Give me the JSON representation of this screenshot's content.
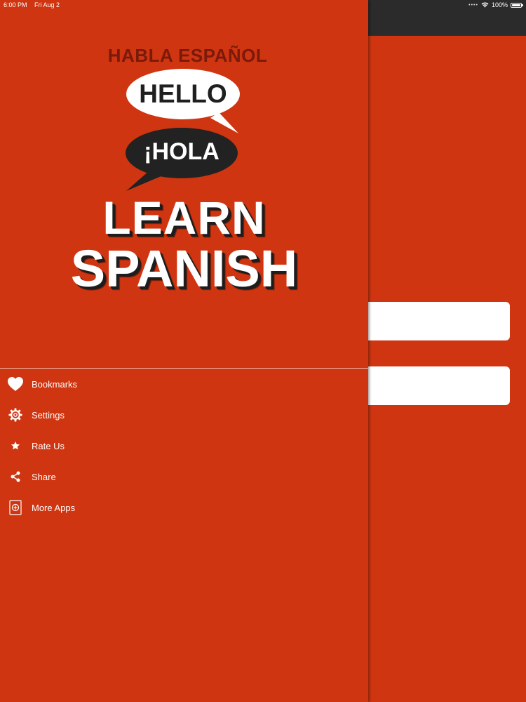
{
  "status_bar": {
    "time": "6:00 PM",
    "date": "Fri Aug 2",
    "battery": "100%",
    "battery_level": 1.0
  },
  "logo": {
    "top_text": "HABLA ESPAÑOL",
    "bubble_1": "HELLO",
    "bubble_2": "¡HOLA",
    "title_line_1": "LEARN",
    "title_line_2": "SPANISH"
  },
  "menu": {
    "items": [
      {
        "label": "Bookmarks",
        "icon": "heart-icon"
      },
      {
        "label": "Settings",
        "icon": "gear-icon"
      },
      {
        "label": "Rate Us",
        "icon": "star-icon"
      },
      {
        "label": "Share",
        "icon": "share-icon"
      },
      {
        "label": "More Apps",
        "icon": "more-apps-icon"
      }
    ]
  },
  "colors": {
    "background": "#cf3510",
    "nav_bar": "#2b2b2b",
    "menu_text": "#ffffff",
    "header_text": "#7a1a0a"
  }
}
